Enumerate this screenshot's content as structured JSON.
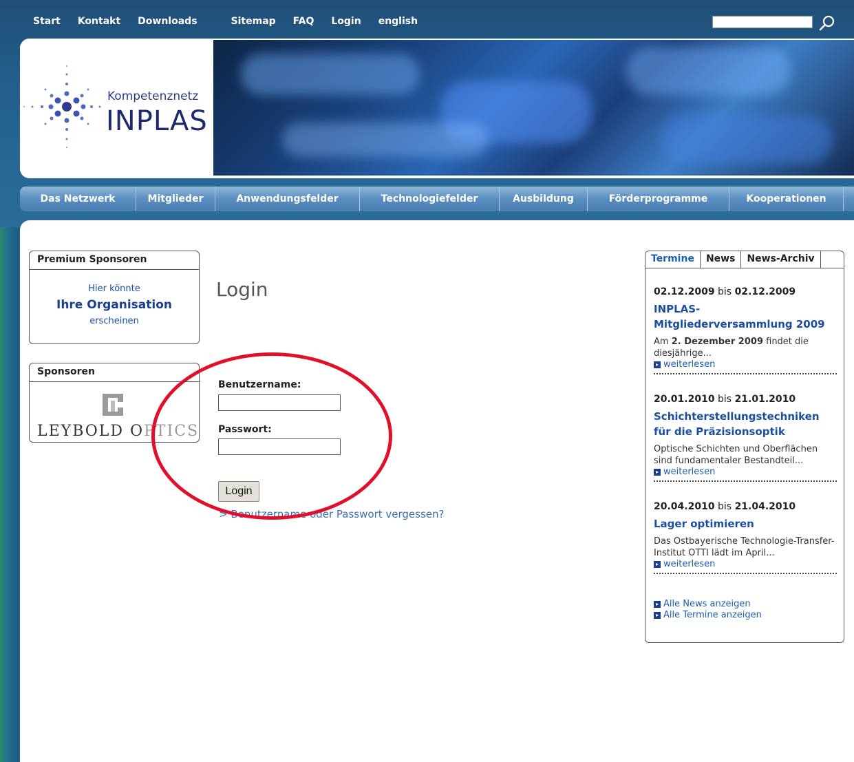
{
  "topnav": {
    "items": [
      "Start",
      "Kontakt",
      "Downloads",
      "Sitemap",
      "FAQ",
      "Login",
      "english"
    ]
  },
  "search": {
    "placeholder": ""
  },
  "logo": {
    "line1": "Kompetenznetz",
    "line2": "INPLAS"
  },
  "mainnav": {
    "items": [
      "Das Netzwerk",
      "Mitglieder",
      "Anwendungsfelder",
      "Technologiefelder",
      "Ausbildung",
      "Förderprogramme",
      "Kooperationen"
    ]
  },
  "premium": {
    "title": "Premium Sponsoren",
    "line1": "Hier könnte",
    "line2": "Ihre Organisation",
    "line3": "erscheinen"
  },
  "sponsors": {
    "title": "Sponsoren",
    "logo_dark": "LEYBOLD O",
    "logo_light": "PTICS"
  },
  "login": {
    "title": "Login",
    "username_label": "Benutzername:",
    "password_label": "Passwort:",
    "button": "Login",
    "forgot": "> Benutzername oder Passwort vergessen?"
  },
  "rightpanel": {
    "tabs": [
      "Termine",
      "News",
      "News-Archiv"
    ],
    "events": [
      {
        "date_from": "02.12.2009",
        "bis": "bis",
        "date_to": "02.12.2009",
        "title": "INPLAS-Mitgliederversammlung 2009",
        "text_pre": "Am ",
        "text_bold": "2. Dezember 2009",
        "text_post": " findet die diesjährige...",
        "more": "weiterlesen"
      },
      {
        "date_from": "20.01.2010",
        "bis": "bis",
        "date_to": "21.01.2010",
        "title": "Schichterstellungstechniken für die Präzisionsoptik",
        "text": "Optische Schichten und Oberflächen sind fundamentaler Bestandteil...",
        "more": "weiterlesen"
      },
      {
        "date_from": "20.04.2010",
        "bis": "bis",
        "date_to": "21.04.2010",
        "title": "Lager optimieren",
        "text": "Das Ostbayerische Technologie-Transfer-Institut OTTI lädt im April...",
        "more": "weiterlesen"
      }
    ],
    "all_news": "Alle News anzeigen",
    "all_events": "Alle Termine anzeigen"
  },
  "colors": {
    "accent": "#1a4fa0",
    "highlight_oval": "#e0102a"
  }
}
